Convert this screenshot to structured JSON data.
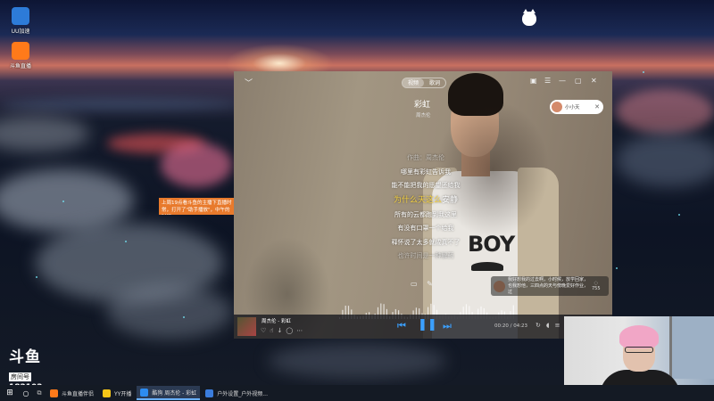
{
  "desktop": {
    "icons": [
      {
        "label": "UU加速",
        "color": "#2d7bd8"
      },
      {
        "label": "斗鱼直播",
        "color": "#ff7a1a"
      }
    ],
    "tooltip": "上周19点看斗鱼的主播下直播时常，打开了\"助手播放\"，中午的时间"
  },
  "douyu": {
    "logo": "斗鱼",
    "room_label": "房间号",
    "room_number": "182102"
  },
  "player": {
    "tabs": [
      "视频",
      "歌词"
    ],
    "song_title": "彩虹",
    "song_artist": "周杰伦",
    "user_badge": "小小天",
    "lyrics": {
      "line_composer": "作曲：周杰伦",
      "line_1": "哪里有彩虹告诉我",
      "line_2": "能不能把我的愿望还给我",
      "current_highlight": "为什么天这么",
      "current_rest": "安静",
      "line_3": "所有的云都跑到我这里",
      "line_4": "有没有口罩一个给我",
      "line_5": "释怀说了太多就成真不了",
      "line_6": "也许时间是一种解药"
    },
    "comment": {
      "text": "我好想我的过去啊，小时候，放学回家，也我想他，三四点的天与傍晚爱好作业，过",
      "count": "755"
    },
    "now_playing": "周杰伦 - 彩虹",
    "time": "00:20 / 04:23"
  },
  "taskbar": {
    "apps": [
      {
        "label": "斗鱼直播伴侣",
        "color": "#ff7a1a",
        "active": false
      },
      {
        "label": "YY开播",
        "color": "#f5c518",
        "active": false
      },
      {
        "label": "酷狗 周杰伦 - 彩虹",
        "color": "#2d8cf0",
        "active": true
      },
      {
        "label": "户外设置_户外视频...",
        "color": "#3b7ddd",
        "active": false
      }
    ]
  }
}
